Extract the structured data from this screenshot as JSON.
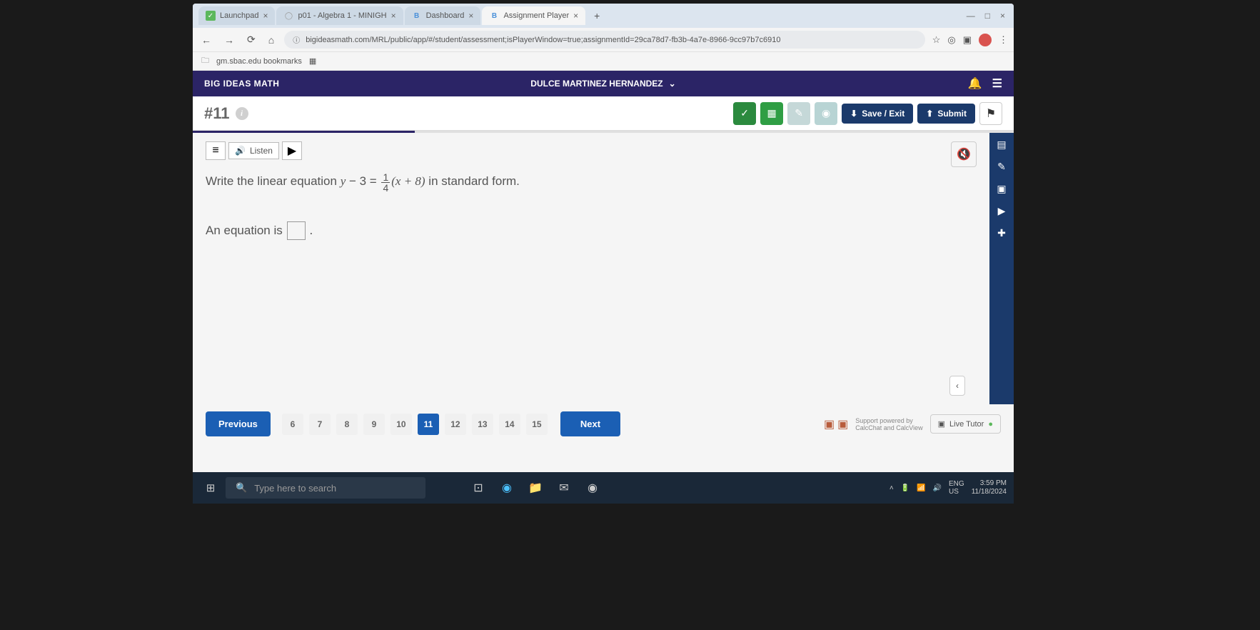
{
  "browser": {
    "tabs": [
      {
        "title": "Launchpad",
        "icon": "✓",
        "icon_color": "#5cb85c"
      },
      {
        "title": "p01 - Algebra 1 - MINIGH",
        "icon": "◯",
        "icon_color": "#999"
      },
      {
        "title": "Dashboard",
        "icon": "B",
        "icon_color": "#4a90d9"
      },
      {
        "title": "Assignment Player",
        "icon": "B",
        "icon_color": "#4a90d9"
      }
    ],
    "url": "bigideasmath.com/MRL/public/app/#/student/assessment;isPlayerWindow=true;assignmentId=29ca78d7-fb3b-4a7e-8966-9cc97b7c6910",
    "bookmark": "gm.sbac.edu bookmarks"
  },
  "app": {
    "title": "BIG IDEAS MATH",
    "user": "DULCE MARTINEZ HERNANDEZ"
  },
  "toolbar": {
    "question_number": "#11",
    "save_exit": "Save / Exit",
    "submit": "Submit"
  },
  "question": {
    "listen_label": "Listen",
    "prompt_prefix": "Write the linear equation ",
    "prompt_var1": "y",
    "prompt_minus": " − 3 = ",
    "frac_num": "1",
    "frac_den": "4",
    "prompt_paren": "(x + 8)",
    "prompt_suffix": " in standard form.",
    "answer_prefix": "An equation is"
  },
  "nav": {
    "previous": "Previous",
    "next": "Next",
    "pages": [
      "6",
      "7",
      "8",
      "9",
      "10",
      "11",
      "12",
      "13",
      "14",
      "15"
    ],
    "active_page": "11"
  },
  "support": {
    "line1": "Support powered by",
    "line2": "CalcChat and CalcView",
    "live_tutor": "Live Tutor"
  },
  "taskbar": {
    "search_placeholder": "Type here to search",
    "lang": "ENG",
    "region": "US",
    "time": "3:59 PM",
    "date": "11/18/2024"
  }
}
